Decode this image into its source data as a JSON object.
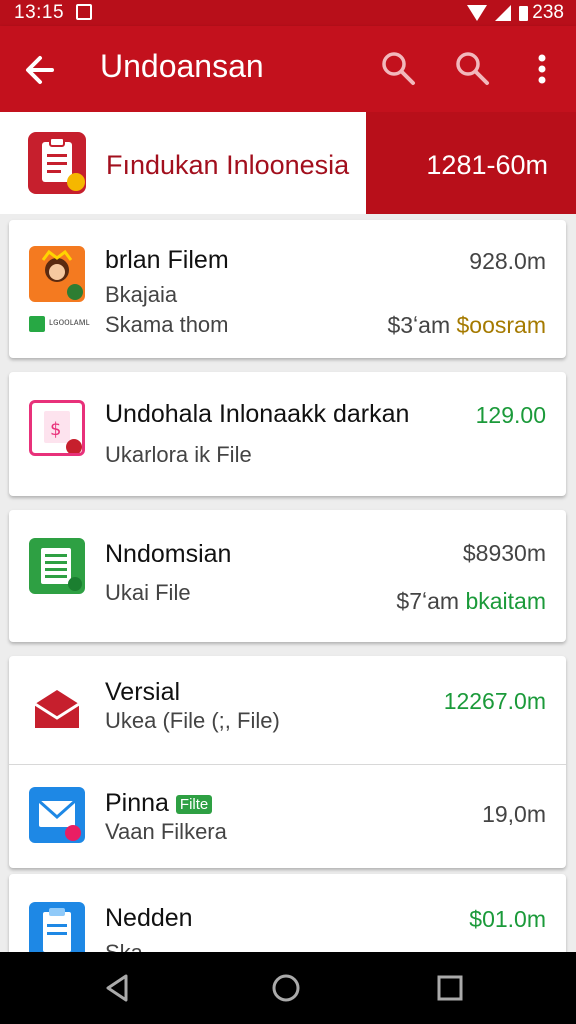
{
  "status_bar": {
    "time": "13:15",
    "battery": "238"
  },
  "app_bar": {
    "title": "Undoansan"
  },
  "summary": {
    "label": "Fındukan Inloonesia",
    "amount": "1281-60m"
  },
  "items": [
    {
      "title": "brlan Filem",
      "line1": "Bkajaia",
      "line2": "Skama thom",
      "amount": "928.0m",
      "amount2_prefix": "$3ʻam",
      "amount2_highlight": "$oosram",
      "badge": "ʟɢᴏᴏʟᴀᴍʟ"
    },
    {
      "title": "Undohala Inlonaakk darkan",
      "line1": "Ukarlora ik File",
      "amount": "129.00"
    },
    {
      "title": "Nndomsian",
      "line1": "Ukai File",
      "amount": "$8930m",
      "amount2_prefix": "$7ʻam",
      "amount2_highlight": "bkaitam"
    },
    {
      "title": "Versial",
      "line1": "Ukea (File (;, File)",
      "amount": "12267.0m"
    },
    {
      "title": "Pinna",
      "tag": "Filte",
      "line1": "Vaan Filkera",
      "amount": "19,0m"
    },
    {
      "title": "Nedden",
      "line1": "Ska ...",
      "amount": "$01.0m"
    }
  ],
  "colors": {
    "primary": "#c3111d",
    "dark_primary": "#b80f1a",
    "green": "#1b9a3a",
    "olive": "#a57a00"
  },
  "icons": [
    "back-arrow-icon",
    "search-icon",
    "more-vert-icon",
    "clipboard-icon",
    "avatar-icon",
    "invoice-icon",
    "spreadsheet-icon",
    "envelope-icon",
    "mail-icon",
    "document-icon",
    "nav-back-icon",
    "nav-home-icon",
    "nav-recents-icon"
  ]
}
